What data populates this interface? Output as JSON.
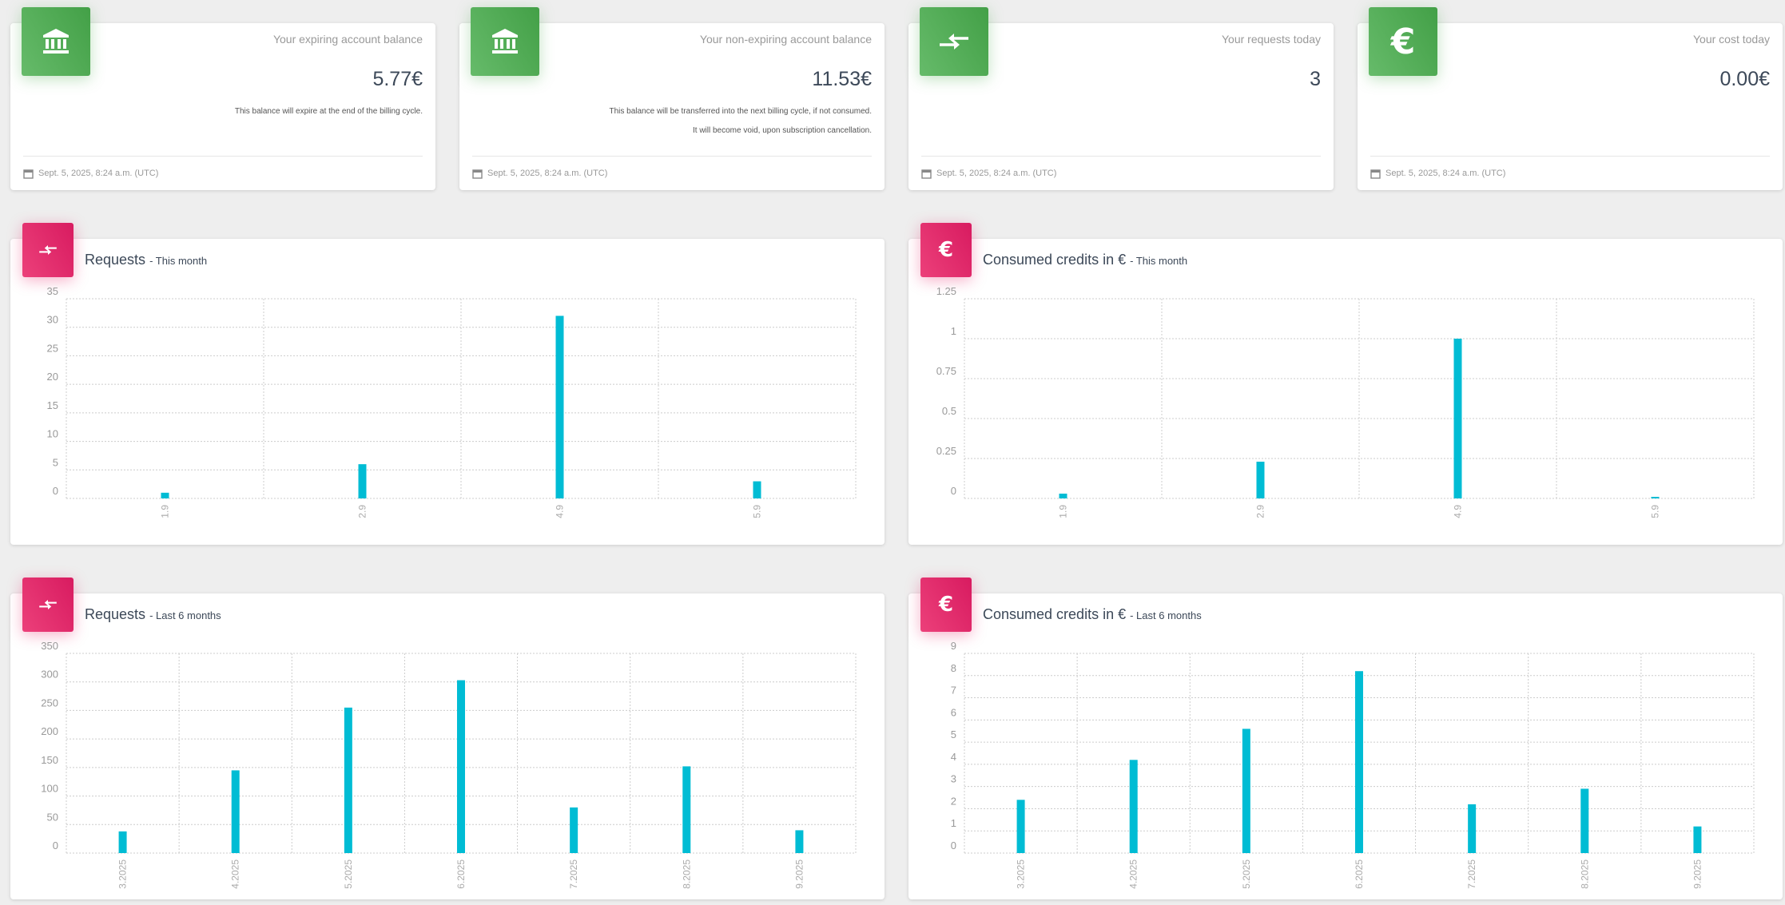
{
  "stats": [
    {
      "title": "Your expiring account balance",
      "value": "5.77€",
      "notes": [
        "This balance will expire at the end of the billing cycle."
      ],
      "footer": "Sept. 5, 2025, 8:24 a.m. (UTC)",
      "icon": "bank-icon"
    },
    {
      "title": "Your non-expiring account balance",
      "value": "11.53€",
      "notes": [
        "This balance will be transferred into the next billing cycle, if not consumed.",
        "It will become void, upon subscription cancellation."
      ],
      "footer": "Sept. 5, 2025, 8:24 a.m. (UTC)",
      "icon": "bank-icon"
    },
    {
      "title": "Your requests today",
      "value": "3",
      "notes": [],
      "footer": "Sept. 5, 2025, 8:24 a.m. (UTC)",
      "icon": "transfer-arrows-icon"
    },
    {
      "title": "Your cost today",
      "value": "0.00€",
      "notes": [],
      "footer": "Sept. 5, 2025, 8:24 a.m. (UTC)",
      "icon": "euro-icon"
    }
  ],
  "colors": {
    "green": "#4caf50",
    "pink": "#e91e63",
    "bar": "#00bcd4",
    "grid": "#cccccc"
  },
  "charts": [
    {
      "title": "Requests",
      "subtitle": "- This month",
      "icon": "transfer-arrows-icon"
    },
    {
      "title": "Consumed credits in €",
      "subtitle": "- This month",
      "icon": "euro-icon"
    },
    {
      "title": "Requests",
      "subtitle": "- Last 6 months",
      "icon": "transfer-arrows-icon"
    },
    {
      "title": "Consumed credits in €",
      "subtitle": "- Last 6 months",
      "icon": "euro-icon"
    }
  ],
  "chart_data": [
    {
      "type": "bar",
      "title": "Requests - This month",
      "categories": [
        "1.9",
        "2.9",
        "4.9",
        "5.9"
      ],
      "values": [
        1,
        6,
        32,
        3
      ],
      "ylim": [
        0,
        35
      ],
      "yticks": [
        "0",
        "5",
        "10",
        "15",
        "20",
        "25",
        "30",
        "35"
      ],
      "grid": true
    },
    {
      "type": "bar",
      "title": "Consumed credits in € - This month",
      "categories": [
        "1.9",
        "2.9",
        "4.9",
        "5.9"
      ],
      "values": [
        0.03,
        0.23,
        1.0,
        0.01
      ],
      "ylim": [
        0,
        1.25
      ],
      "yticks": [
        "0",
        "0.25",
        "0.5",
        "0.75",
        "1",
        "1.25"
      ],
      "grid": true
    },
    {
      "type": "bar",
      "title": "Requests - Last 6 months",
      "categories": [
        "3.2025",
        "4.2025",
        "5.2025",
        "6.2025",
        "7.2025",
        "8.2025",
        "9.2025"
      ],
      "values": [
        38,
        145,
        255,
        303,
        80,
        152,
        40
      ],
      "ylim": [
        0,
        350
      ],
      "yticks": [
        "0",
        "50",
        "100",
        "150",
        "200",
        "250",
        "300",
        "350"
      ],
      "grid": true
    },
    {
      "type": "bar",
      "title": "Consumed credits in € - Last 6 months",
      "categories": [
        "3.2025",
        "4.2025",
        "5.2025",
        "6.2025",
        "7.2025",
        "8.2025",
        "9.2025"
      ],
      "values": [
        2.4,
        4.2,
        5.6,
        8.2,
        2.2,
        2.9,
        1.2
      ],
      "ylim": [
        0,
        9
      ],
      "yticks": [
        "0",
        "1",
        "2",
        "3",
        "4",
        "5",
        "6",
        "7",
        "8",
        "9"
      ],
      "grid": true
    }
  ]
}
